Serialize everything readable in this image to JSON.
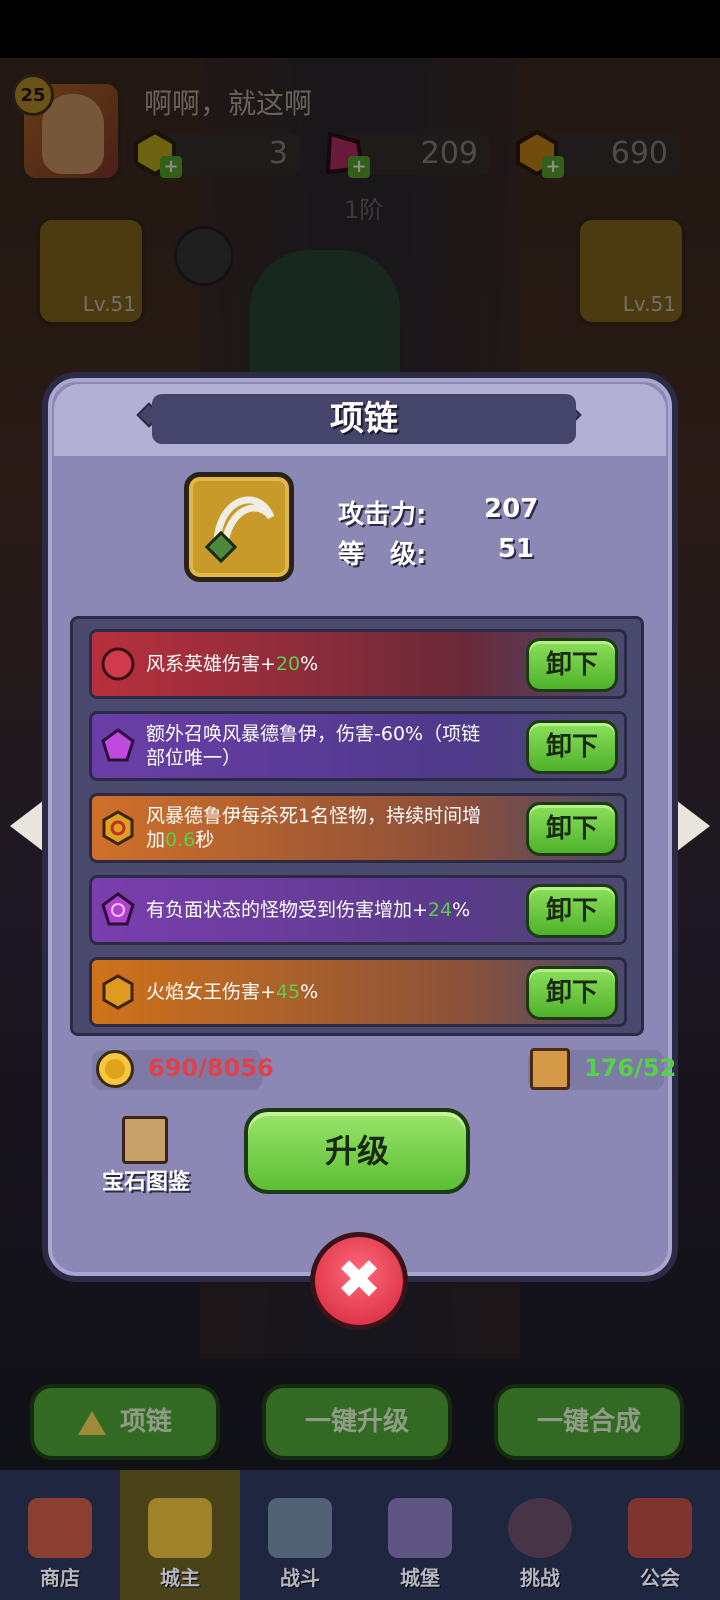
{
  "player": {
    "name": "啊啊，就这啊",
    "level": "25"
  },
  "resources": {
    "gem_a": "3",
    "gem_b": "209",
    "gold": "690"
  },
  "tier": "1阶",
  "slots": {
    "left_level": "Lv.51",
    "right_level": "Lv.51"
  },
  "modal": {
    "title": "项链",
    "stats": {
      "attack_label": "攻击力:",
      "attack_value": "207",
      "level_label": "等　级:",
      "level_value": "51"
    },
    "gems": [
      {
        "pre": "风系英雄伤害+",
        "num": "20",
        "post": "%",
        "color": "#a8303a",
        "button": "卸下",
        "icon": "red-gem-icon"
      },
      {
        "pre": "额外召唤风暴德鲁伊，伤害-60%（项链部位唯一）",
        "num": "",
        "post": "",
        "color": "#6a3ea8",
        "button": "卸下",
        "icon": "purple-pentagon-gem-icon"
      },
      {
        "pre": "风暴德鲁伊每杀死1名怪物，持续时间增加",
        "num": "0.6",
        "post": "秒",
        "color": "#c86a2a",
        "button": "卸下",
        "icon": "orange-hexagon-gem-icon"
      },
      {
        "pre": "有负面状态的怪物受到伤害增加+",
        "num": "24",
        "post": "%",
        "color": "#7a3eae",
        "button": "卸下",
        "icon": "purple-spiral-gem-icon"
      },
      {
        "pre": "火焰女王伤害+",
        "num": "45",
        "post": "%",
        "color": "#c8701a",
        "button": "卸下",
        "icon": "orange-hexagon-gem-icon"
      }
    ],
    "cost_gold": "690/8056",
    "cost_scroll": "176/52",
    "book_label": "宝石图鉴",
    "upgrade_label": "升级",
    "close_symbol": "✖"
  },
  "bottom_buttons": {
    "equip": "项链",
    "upgrade_all": "一键升级",
    "merge_all": "一键合成"
  },
  "tabs": [
    "商店",
    "城主",
    "战斗",
    "城堡",
    "挑战",
    "公会"
  ],
  "colors": {
    "accent_green": "#57d04a",
    "cost_red": "#e0404a",
    "panel": "#8b88b6"
  }
}
